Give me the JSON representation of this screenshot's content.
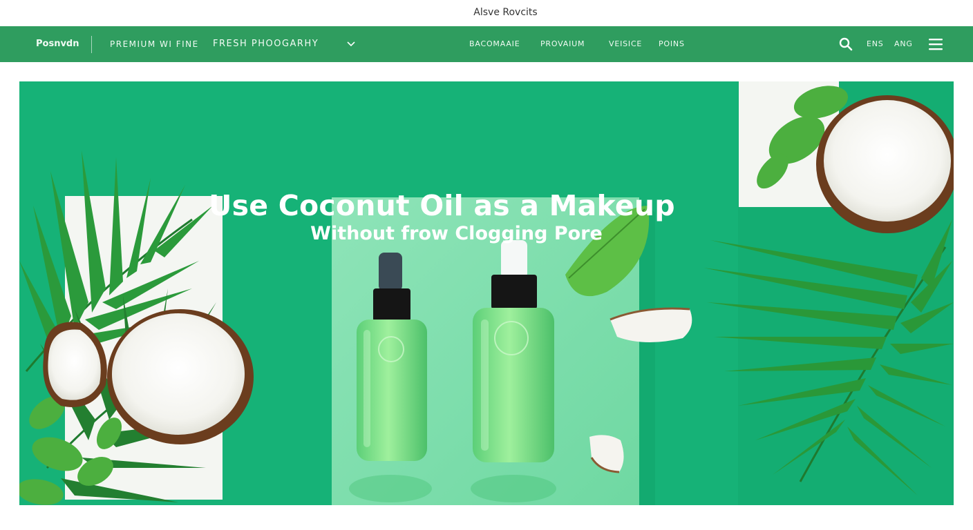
{
  "top_bar": {
    "title": "Alsve Rovcits"
  },
  "navbar": {
    "brand": "Posnvdn",
    "left_items": [
      "PREMIUM WI FINE",
      "FRESH PHOOGARHY"
    ],
    "mid_items": [
      "BACOMAAIE",
      "PROVAIUM",
      "VEISICE",
      "POINS"
    ],
    "right_items": [
      "ENS",
      "ANG"
    ],
    "icons": [
      "chevron-down-icon",
      "search-icon",
      "hamburger-menu-icon"
    ]
  },
  "hero": {
    "title": "Use Coconut Oil as a Makeup",
    "subtitle": "Without frow Clogging Pore"
  },
  "colors": {
    "nav_green": "#2f9d5f",
    "hero_green": "#15b276",
    "panel_light_green": "#84deb0",
    "text_white": "#ffffff"
  }
}
